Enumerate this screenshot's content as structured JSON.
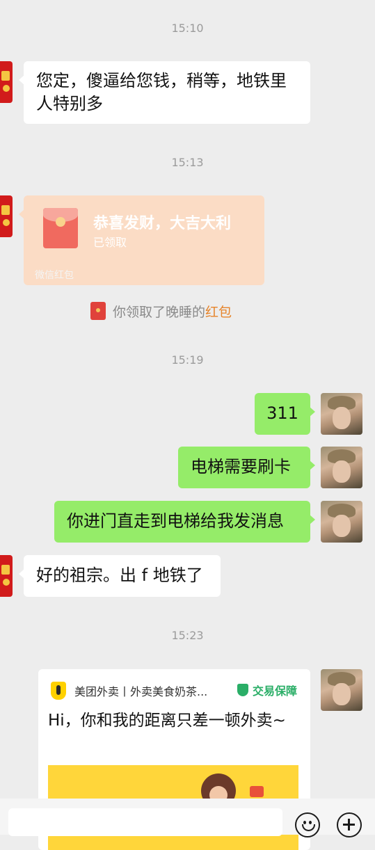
{
  "timestamps": [
    "15:10",
    "15:13",
    "15:19",
    "15:23"
  ],
  "messages": {
    "m1": "您定，傻逼给您钱，稍等，地铁里人特别多",
    "m2": "311",
    "m3": "电梯需要刷卡",
    "m4": "你进门直走到电梯给我发消息",
    "m5": "好的祖宗。出 f 地铁了"
  },
  "red_packet": {
    "title": "恭喜发财，大吉大利",
    "status": "已领取",
    "brand": "微信红包"
  },
  "system_notice": {
    "text": "你领取了晚睡的",
    "link": "红包"
  },
  "share_card": {
    "source": "美团外卖丨外卖美食奶茶...",
    "badge": "交易保障",
    "title": "Hi，你和我的距离只差一顿外卖~"
  },
  "icons": {
    "emoji": "smiley-icon",
    "plus": "plus-icon"
  },
  "colors": {
    "background": "#ededed",
    "sent_bubble": "#95ec69",
    "received_bubble": "#ffffff",
    "red_packet": "#fbdcc5",
    "link": "#e6852c",
    "badge": "#2aae67"
  }
}
